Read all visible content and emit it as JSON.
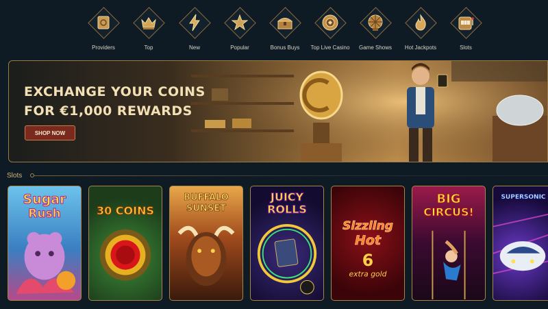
{
  "nav": {
    "items": [
      {
        "label": "Providers",
        "icon": "providers-icon"
      },
      {
        "label": "Top",
        "icon": "crown-icon"
      },
      {
        "label": "New",
        "icon": "lightning-icon"
      },
      {
        "label": "Popular",
        "icon": "star-icon"
      },
      {
        "label": "Bonus Buys",
        "icon": "chest-icon"
      },
      {
        "label": "Top Live Casino",
        "icon": "chip-icon"
      },
      {
        "label": "Game Shows",
        "icon": "wheel-icon"
      },
      {
        "label": "Hot Jackpots",
        "icon": "flame-icon"
      },
      {
        "label": "Slots",
        "icon": "slot-machine-icon"
      }
    ]
  },
  "banner": {
    "title_line1": "EXCHANGE YOUR COINS",
    "title_line2": "FOR €1,000 REWARDS",
    "cta": "SHOP NOW"
  },
  "slots": {
    "heading": "Slots",
    "games": [
      {
        "title1": "Sugar",
        "title2": "Rush",
        "bg": "#4fa7d8"
      },
      {
        "title1": "30 COINS",
        "title2": "",
        "bg": "#2c5a2a"
      },
      {
        "title1": "BUFFALO",
        "title2": "SUNSET",
        "bg": "#5a2a14"
      },
      {
        "title1": "JUICY",
        "title2": "ROLLS",
        "bg": "#2a1a48"
      },
      {
        "title1": "Sizzling",
        "title2": "Hot",
        "bg": "#5a0c10"
      },
      {
        "title1": "BIG",
        "title2": "CIRCUS!",
        "bg": "#3a0e3e"
      },
      {
        "title1": "SUPERSONIC",
        "title2": "",
        "bg": "#1c1450"
      }
    ]
  }
}
